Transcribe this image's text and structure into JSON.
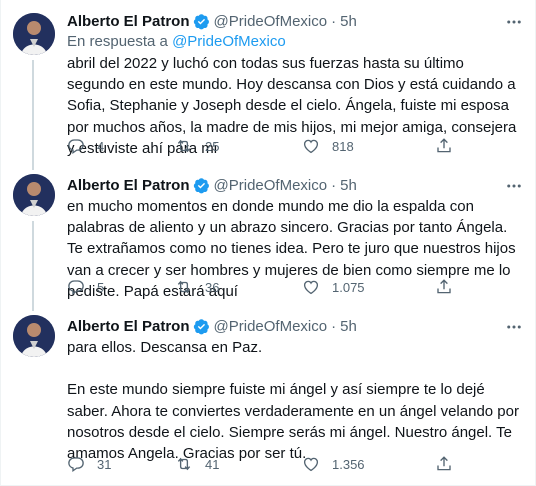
{
  "tweets": [
    {
      "author": "Alberto El Patron",
      "handle": "@PrideOfMexico",
      "separator": "·",
      "time": "5h",
      "reply_prefix": "En respuesta a ",
      "reply_handle": "@PrideOfMexico",
      "text": "abril del 2022 y luchó con todas sus fuerzas hasta su último segundo en este mundo. Hoy descansa con Dios y está cuidando a Sofia, Stephanie y Joseph desde el cielo. Ángela, fuiste mi esposa por muchos años, la madre de mis hijos, mi mejor amiga, consejera y estuviste ahí para mi",
      "replies": "4",
      "retweets": "25",
      "likes": "818"
    },
    {
      "author": "Alberto El Patron",
      "handle": "@PrideOfMexico",
      "separator": "·",
      "time": "5h",
      "text": "en mucho momentos en donde mundo me dio la espalda con palabras de aliento y un abrazo sincero. Gracias por tanto Ángela. Te extrañamos como no tienes idea. Pero te juro que nuestros hijos van a crecer y ser hombres y mujeres de bien como siempre me lo pediste. Papá estará aquí",
      "replies": "5",
      "retweets": "36",
      "likes": "1.075"
    },
    {
      "author": "Alberto El Patron",
      "handle": "@PrideOfMexico",
      "separator": "·",
      "time": "5h",
      "text": "para ellos. Descansa en Paz.\n\nEn este mundo siempre fuiste mi ángel y así siempre te lo dejé saber. Ahora te conviertes verdaderamente en un ángel velando por nosotros desde el cielo. Siempre serás mi ángel. Nuestro ángel. Te amamos Angela. Gracias por ser tú.",
      "replies": "31",
      "retweets": "41",
      "likes": "1.356"
    }
  ],
  "colors": {
    "accent": "#1d9bf0",
    "secondary_text": "#536471",
    "primary_text": "#0f1419",
    "divider": "#eff3f4"
  },
  "icons": [
    "verified-badge-icon",
    "more-options-icon",
    "reply-icon",
    "retweet-icon",
    "like-icon",
    "share-icon"
  ]
}
